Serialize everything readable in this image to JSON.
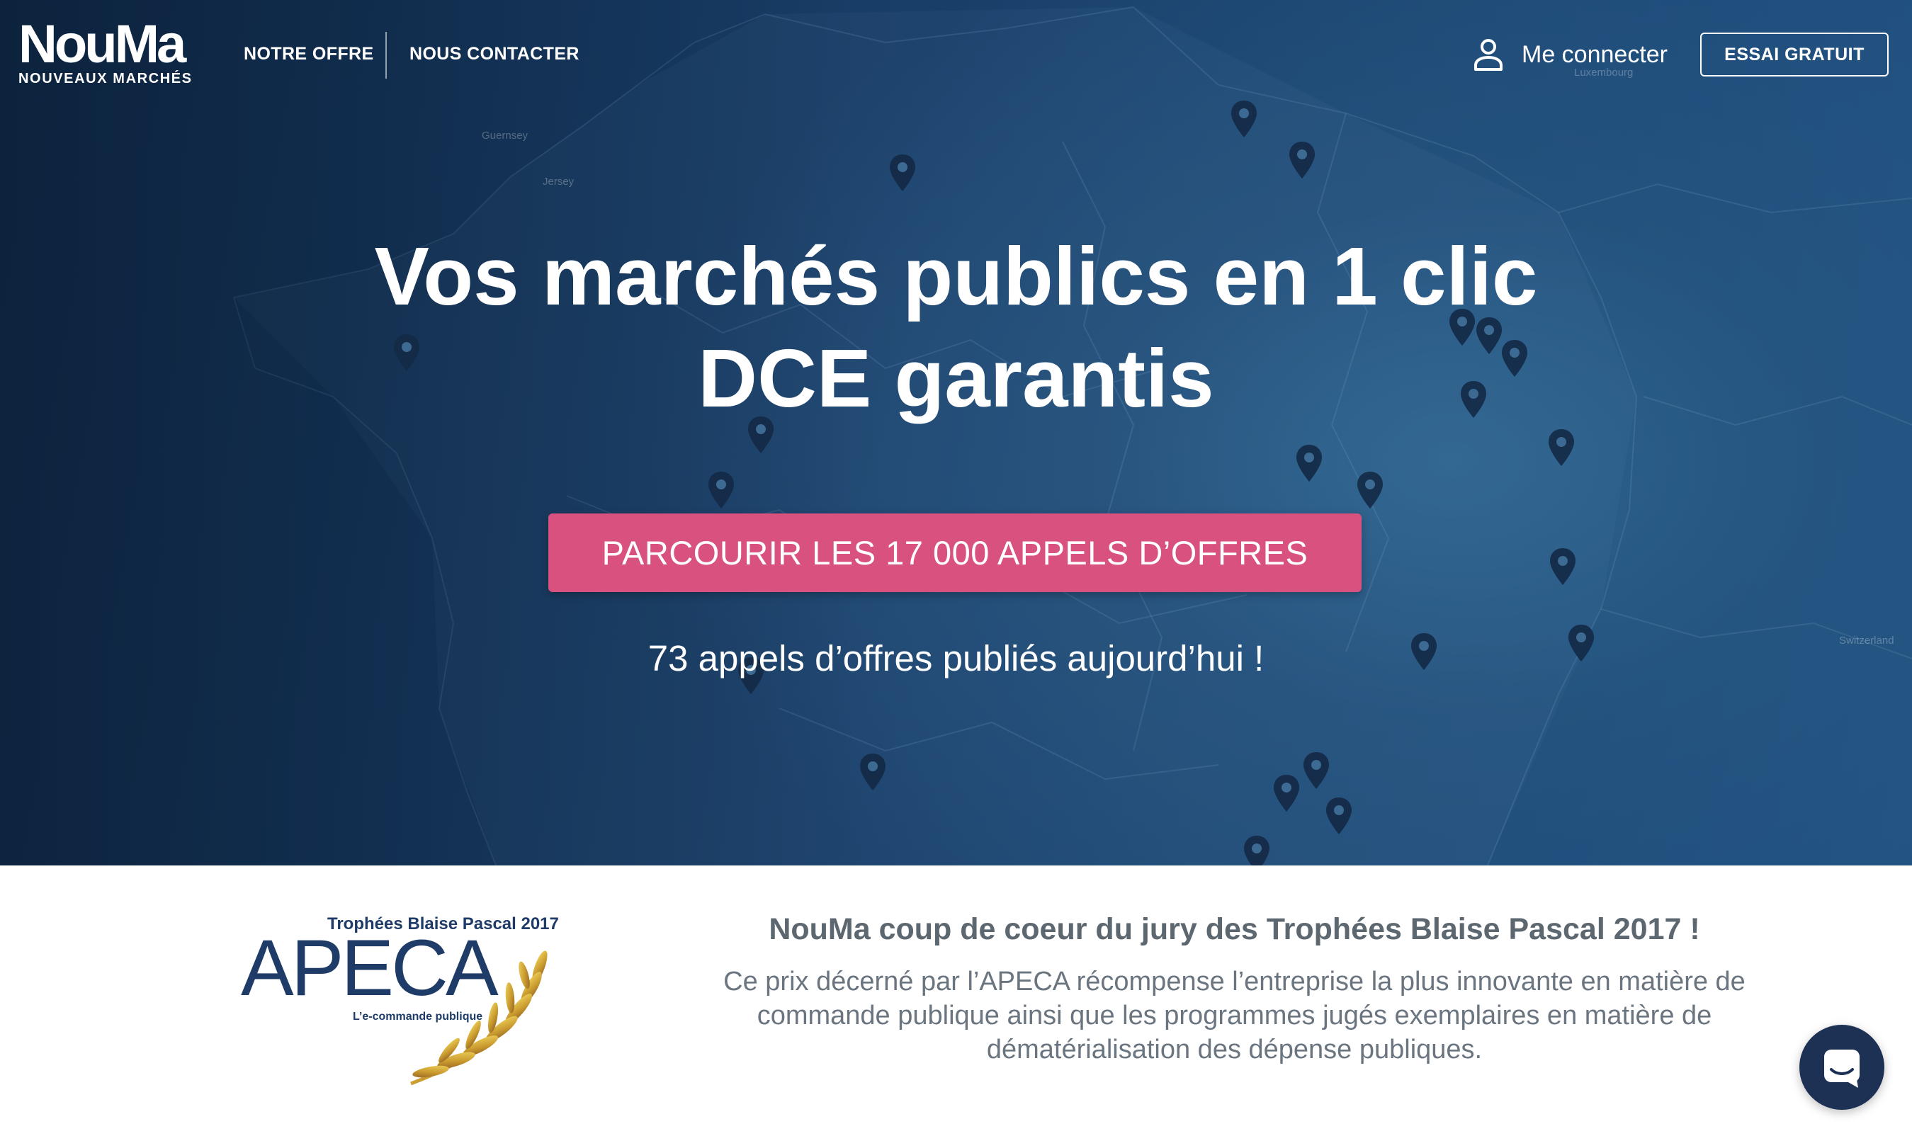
{
  "header": {
    "logo_word": "NouMa",
    "logo_sub": "NOUVEAUX MARCHÉS",
    "nav": [
      {
        "label": "NOTRE OFFRE"
      },
      {
        "label": "NOUS CONTACTER"
      }
    ],
    "login_label": "Me connecter",
    "login_icon": "user-icon",
    "trial_label": "ESSAI GRATUIT"
  },
  "hero": {
    "title_line1": "Vos marchés publics en 1 clic",
    "title_line2": "DCE garantis",
    "cta_label": "PARCOURIR LES 17 000  APPELS D’OFFRES",
    "today_text": "73 appels d’offres publiés aujourd’hui !",
    "map_labels": [
      "Luxembourg",
      "Switzerland",
      "Guernsey",
      "Jersey"
    ],
    "marker_icon": "map-pin-icon"
  },
  "award": {
    "logo_top": "Trophées Blaise Pascal 2017",
    "logo_word": "APECA",
    "logo_sub": "L’e-commande publique",
    "title": "NouMa coup de coeur du jury des Trophées Blaise Pascal 2017 !",
    "description": "Ce prix décerné par l’APECA récompense l’entreprise la plus innovante en matière de commande publique ainsi que les programmes jugés exemplaires en matière de dématérialisation des dépense publiques."
  },
  "chat": {
    "icon": "chat-bubble-icon"
  },
  "colors": {
    "hero_bg": "#1d4774",
    "cta": "#d9517e",
    "brand_navy": "#1f3c68",
    "chat_button": "#1c3153",
    "text_grey": "#5c6770"
  }
}
